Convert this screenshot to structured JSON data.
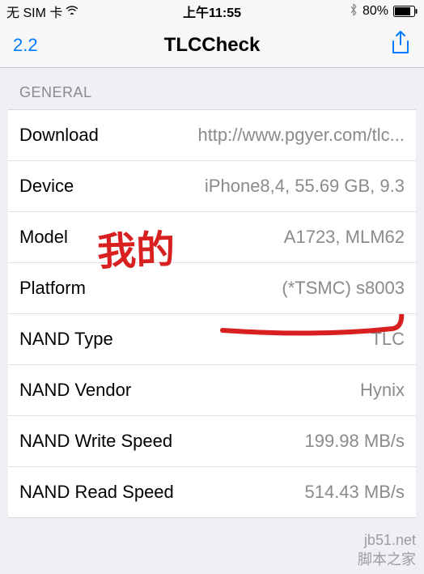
{
  "status_bar": {
    "carrier": "无 SIM 卡",
    "time": "上午11:55",
    "battery_pct": "80%"
  },
  "nav": {
    "back_label": "2.2",
    "title": "TLCCheck"
  },
  "section_header": "GENERAL",
  "rows": [
    {
      "label": "Download",
      "value": "http://www.pgyer.com/tlc..."
    },
    {
      "label": "Device",
      "value": "iPhone8,4, 55.69 GB, 9.3"
    },
    {
      "label": "Model",
      "value": "A1723, MLM62"
    },
    {
      "label": "Platform",
      "value": "(*TSMC) s8003"
    },
    {
      "label": "NAND Type",
      "value": "TLC"
    },
    {
      "label": "NAND Vendor",
      "value": "Hynix"
    },
    {
      "label": "NAND Write Speed",
      "value": "199.98 MB/s"
    },
    {
      "label": "NAND Read Speed",
      "value": "514.43 MB/s"
    }
  ],
  "handwriting_text": "我的",
  "watermark": {
    "line1": "jb51.net",
    "line2": "脚本之家"
  }
}
